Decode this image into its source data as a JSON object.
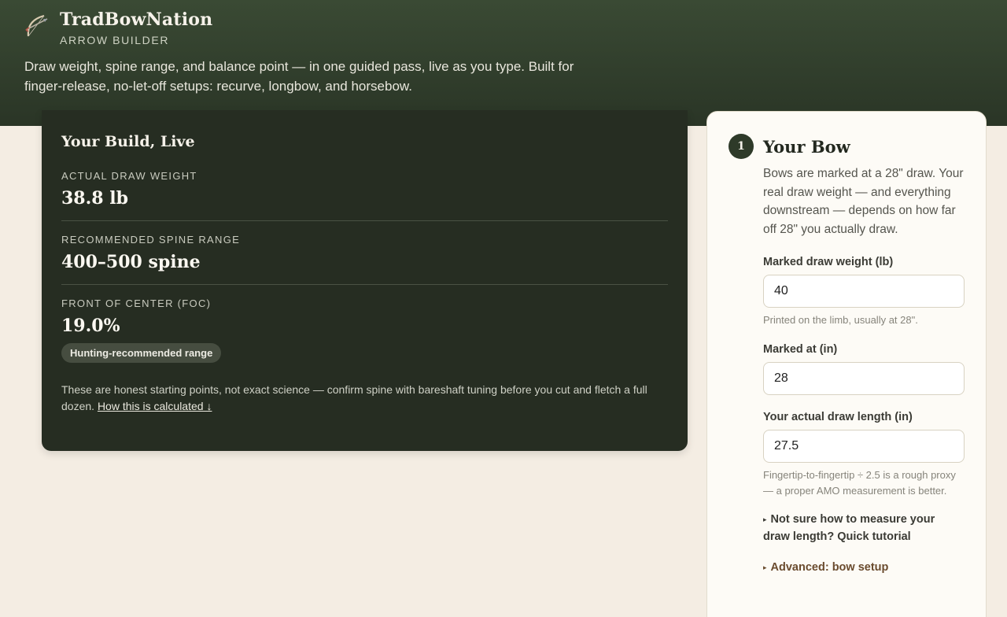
{
  "brand": {
    "name": "TradBowNation",
    "subtitle": "ARROW BUILDER",
    "logo_icon": "bow-and-arrow-icon"
  },
  "hero": {
    "tagline": "Draw weight, spine range, and balance point — in one guided pass, live as you type. Built for finger-release, no-let-off setups: recurve, longbow, and horsebow."
  },
  "summary": {
    "title": "Your Build, Live",
    "metrics": [
      {
        "label": "ACTUAL DRAW WEIGHT",
        "value": "38.8 lb"
      },
      {
        "label": "RECOMMENDED SPINE RANGE",
        "value": "400–500 spine"
      },
      {
        "label": "FRONT OF CENTER (FOC)",
        "value": "19.0%",
        "badge": "Hunting-recommended range"
      }
    ],
    "disclaimer": "These are honest starting points, not exact science — confirm spine with bareshaft tuning before you cut and fletch a full dozen.",
    "calc_link": "How this is calculated ↓"
  },
  "bow_step": {
    "number": "1",
    "title": "Your Bow",
    "description": "Bows are marked at a 28\" draw. Your real draw weight — and everything downstream — depends on how far off 28\" you actually draw.",
    "fields": [
      {
        "label": "Marked draw weight (lb)",
        "value": "40",
        "help": "Printed on the limb, usually at 28\"."
      },
      {
        "label": "Marked at (in)",
        "value": "28",
        "help": ""
      },
      {
        "label": "Your actual draw length (in)",
        "value": "27.5",
        "help": "Fingertip-to-fingertip ÷ 2.5 is a rough proxy — a proper AMO measurement is better."
      }
    ],
    "tutorial_toggle": "Not sure how to measure your draw length? Quick tutorial",
    "advanced_toggle": "Advanced: bow setup"
  },
  "colors": {
    "hero_bg": "#2f3b2b",
    "summary_bg": "#262d22",
    "page_bg": "#f4ede3",
    "accent_brown": "#6a4b2e"
  }
}
